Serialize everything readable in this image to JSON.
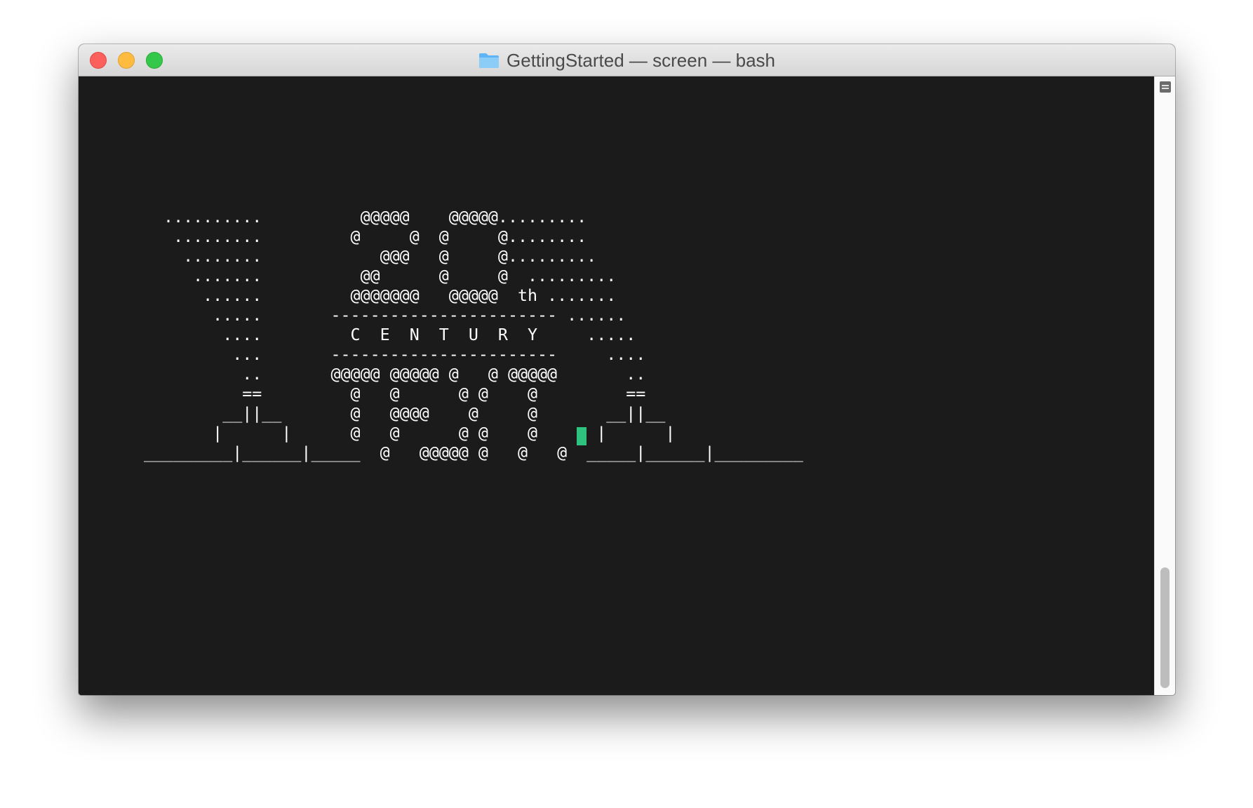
{
  "window": {
    "title": "GettingStarted — screen — bash",
    "folder_icon": "folder-icon"
  },
  "terminal": {
    "ascii_art": "  ..........          @@@@@    @@@@@.........\n   .........         @     @  @     @........\n    ........            @@@   @     @.........\n     .......          @@      @     @  .........\n      ......         @@@@@@@   @@@@@  th .......\n       .....       ----------------------- ......\n        ....         C  E  N  T  U  R  Y     .....\n         ...       -----------------------     ....\n          ..       @@@@@ @@@@@ @   @ @@@@@       ..\n          ==         @   @      @ @    @         ==\n        __||__       @   @@@@    @     @       __||__\n       |      |      @   @      @ @    @      |      |\n_________|______|_____  @   @@@@@ @   @   @  _____|______|_________",
    "cursor_color": "#2ec27e"
  },
  "colors": {
    "close": "#fc605c",
    "minimize": "#fdbc40",
    "zoom": "#34c84a",
    "terminal_bg": "#1b1b1b",
    "terminal_fg": "#ffffff"
  }
}
